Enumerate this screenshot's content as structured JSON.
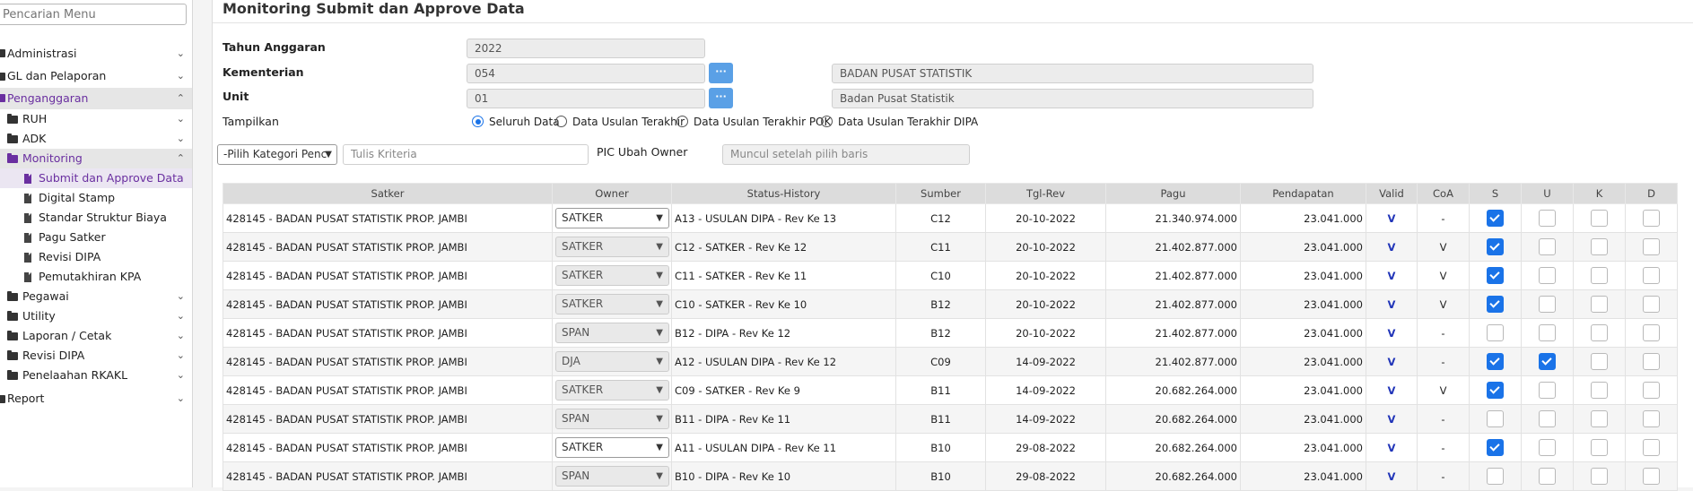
{
  "sidebar": {
    "search_placeholder": "Pencarian Menu",
    "items": [
      {
        "label": "Administrasi"
      },
      {
        "label": "GL dan Pelaporan"
      },
      {
        "label": "Penganggaran"
      },
      {
        "label": "RUH"
      },
      {
        "label": "ADK"
      },
      {
        "label": "Monitoring"
      },
      {
        "label": "Submit dan Approve Data"
      },
      {
        "label": "Digital Stamp"
      },
      {
        "label": "Standar Struktur Biaya"
      },
      {
        "label": "Pagu Satker"
      },
      {
        "label": "Revisi DIPA"
      },
      {
        "label": "Pemutakhiran KPA"
      },
      {
        "label": "Pegawai"
      },
      {
        "label": "Utility"
      },
      {
        "label": "Laporan / Cetak"
      },
      {
        "label": "Revisi DIPA"
      },
      {
        "label": "Penelaahan RKAKL"
      },
      {
        "label": "Report"
      }
    ]
  },
  "page": {
    "title": "Monitoring Submit dan Approve Data"
  },
  "form": {
    "tahun_label": "Tahun Anggaran",
    "tahun_value": "2022",
    "kementerian_label": "Kementerian",
    "kementerian_code": "054",
    "kementerian_name": "BADAN PUSAT STATISTIK",
    "unit_label": "Unit",
    "unit_code": "01",
    "unit_name": "Badan Pusat Statistik",
    "dots_label": "···",
    "tampilkan_label": "Tampilkan",
    "options": [
      "Seluruh Data",
      "Data Usulan Terakhir",
      "Data Usulan Terakhir POK",
      "Data Usulan Terakhir DIPA"
    ],
    "selected_option": "Seluruh Data",
    "kategori_select": "-Pilih Kategori Penc",
    "kriteria_placeholder": "Tulis Kriteria",
    "pic_label": "PIC Ubah Owner",
    "pic_placeholder": "Muncul setelah pilih baris"
  },
  "table": {
    "headers": [
      "Satker",
      "Owner",
      "Status-History",
      "Sumber",
      "Tgl-Rev",
      "Pagu",
      "Pendapatan",
      "Valid",
      "CoA",
      "S",
      "U",
      "K",
      "D"
    ],
    "rows": [
      {
        "satker": "428145 - BADAN PUSAT STATISTIK PROP. JAMBI",
        "owner": "SATKER",
        "owner_enabled": true,
        "status": "A13 - USULAN DIPA - Rev Ke 13",
        "sumber": "C12",
        "tgl": "20-10-2022",
        "pagu": "21.340.974.000",
        "pendapatan": "23.041.000",
        "valid": "V",
        "coa": "-",
        "s": true,
        "u": false,
        "k": false,
        "d": false
      },
      {
        "satker": "428145 - BADAN PUSAT STATISTIK PROP. JAMBI",
        "owner": "SATKER",
        "owner_enabled": false,
        "status": "C12 - SATKER - Rev Ke 12",
        "sumber": "C11",
        "tgl": "20-10-2022",
        "pagu": "21.402.877.000",
        "pendapatan": "23.041.000",
        "valid": "V",
        "coa": "V",
        "s": true,
        "u": false,
        "k": false,
        "d": false
      },
      {
        "satker": "428145 - BADAN PUSAT STATISTIK PROP. JAMBI",
        "owner": "SATKER",
        "owner_enabled": false,
        "status": "C11 - SATKER - Rev Ke 11",
        "sumber": "C10",
        "tgl": "20-10-2022",
        "pagu": "21.402.877.000",
        "pendapatan": "23.041.000",
        "valid": "V",
        "coa": "V",
        "s": true,
        "u": false,
        "k": false,
        "d": false
      },
      {
        "satker": "428145 - BADAN PUSAT STATISTIK PROP. JAMBI",
        "owner": "SATKER",
        "owner_enabled": false,
        "status": "C10 - SATKER - Rev Ke 10",
        "sumber": "B12",
        "tgl": "20-10-2022",
        "pagu": "21.402.877.000",
        "pendapatan": "23.041.000",
        "valid": "V",
        "coa": "V",
        "s": true,
        "u": false,
        "k": false,
        "d": false
      },
      {
        "satker": "428145 - BADAN PUSAT STATISTIK PROP. JAMBI",
        "owner": "SPAN",
        "owner_enabled": false,
        "status": "B12 - DIPA - Rev Ke 12",
        "sumber": "B12",
        "tgl": "20-10-2022",
        "pagu": "21.402.877.000",
        "pendapatan": "23.041.000",
        "valid": "V",
        "coa": "-",
        "s": false,
        "u": false,
        "k": false,
        "d": false
      },
      {
        "satker": "428145 - BADAN PUSAT STATISTIK PROP. JAMBI",
        "owner": "DJA",
        "owner_enabled": false,
        "status": "A12 - USULAN DIPA - Rev Ke 12",
        "sumber": "C09",
        "tgl": "14-09-2022",
        "pagu": "21.402.877.000",
        "pendapatan": "23.041.000",
        "valid": "V",
        "coa": "-",
        "s": true,
        "u": true,
        "k": false,
        "d": false
      },
      {
        "satker": "428145 - BADAN PUSAT STATISTIK PROP. JAMBI",
        "owner": "SATKER",
        "owner_enabled": false,
        "status": "C09 - SATKER - Rev Ke 9",
        "sumber": "B11",
        "tgl": "14-09-2022",
        "pagu": "20.682.264.000",
        "pendapatan": "23.041.000",
        "valid": "V",
        "coa": "V",
        "s": true,
        "u": false,
        "k": false,
        "d": false
      },
      {
        "satker": "428145 - BADAN PUSAT STATISTIK PROP. JAMBI",
        "owner": "SPAN",
        "owner_enabled": false,
        "status": "B11 - DIPA - Rev Ke 11",
        "sumber": "B11",
        "tgl": "14-09-2022",
        "pagu": "20.682.264.000",
        "pendapatan": "23.041.000",
        "valid": "V",
        "coa": "-",
        "s": false,
        "u": false,
        "k": false,
        "d": false
      },
      {
        "satker": "428145 - BADAN PUSAT STATISTIK PROP. JAMBI",
        "owner": "SATKER",
        "owner_enabled": true,
        "status": "A11 - USULAN DIPA - Rev Ke 11",
        "sumber": "B10",
        "tgl": "29-08-2022",
        "pagu": "20.682.264.000",
        "pendapatan": "23.041.000",
        "valid": "V",
        "coa": "-",
        "s": true,
        "u": false,
        "k": false,
        "d": false
      },
      {
        "satker": "428145 - BADAN PUSAT STATISTIK PROP. JAMBI",
        "owner": "SPAN",
        "owner_enabled": false,
        "status": "B10 - DIPA - Rev Ke 10",
        "sumber": "B10",
        "tgl": "29-08-2022",
        "pagu": "20.682.264.000",
        "pendapatan": "23.041.000",
        "valid": "V",
        "coa": "-",
        "s": false,
        "u": false,
        "k": false,
        "d": false
      }
    ]
  }
}
